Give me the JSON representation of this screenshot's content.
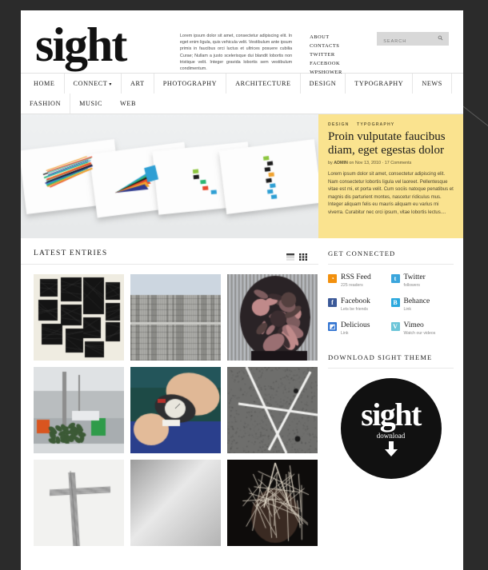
{
  "site": {
    "logo_text": "sight",
    "tagline": "Lorem ipsum dolor sit amet, consectetur adipiscing elit. In eget enim ligula, quis vehicula velit. Vestibulum ante ipsum primis in faucibus orci luctus et ultrices posuere cubilia Curae; Nullam a justo scelerisque dui blandit lobortis non tristique velit. Integer gravida lobortis sem vestibulum condimentum."
  },
  "header_links": [
    {
      "label": "ABOUT"
    },
    {
      "label": "CONTACTS"
    },
    {
      "label": "TWITTER"
    },
    {
      "label": "FACEBOOK"
    },
    {
      "label": "WPSHOWER"
    }
  ],
  "search": {
    "placeholder": "SEARCH",
    "value": "",
    "icon": "search-icon"
  },
  "nav": [
    {
      "label": "HOME",
      "has_caret": false
    },
    {
      "label": "CONNECT",
      "has_caret": true
    },
    {
      "label": "ART",
      "has_caret": false
    },
    {
      "label": "PHOTOGRAPHY",
      "has_caret": false
    },
    {
      "label": "ARCHITECTURE",
      "has_caret": false
    },
    {
      "label": "DESIGN",
      "has_caret": false
    },
    {
      "label": "TYPOGRAPHY",
      "has_caret": false
    },
    {
      "label": "NEWS",
      "has_caret": false
    },
    {
      "label": "FASHION",
      "has_caret": false
    },
    {
      "label": "MUSIC",
      "has_caret": false
    },
    {
      "label": "WEB",
      "has_caret": false
    }
  ],
  "feature": {
    "categories": [
      "DESIGN",
      "TYPOGRAPHY"
    ],
    "title": "Proin vulputate faucibus diam, eget egestas dolor",
    "meta_by": "by",
    "meta_author": "ADMIN",
    "meta_on": "on",
    "meta_date": "Nov 13, 2010",
    "meta_sep": "·",
    "meta_comments": "17 Comments",
    "excerpt": "Lorem ipsum dolor sit amet, consectetur adipiscing elit. Nam consectetur lobortis ligula vel laoreet. Pellentesque vitae est mi, et porta velit. Cum sociis natoque penatibus et magnis dis parturient montes, nascetur ridiculus mus. Integer aliquam felis eu mauris aliquam eu varius mi viverra. Curabitur nec orci ipsum, vitae lobortis lectus....",
    "accent_color": "#fae38f"
  },
  "latest": {
    "title": "LATEST ENTRIES",
    "view_list_icon": "list-view-icon",
    "view_grid_icon": "grid-view-icon",
    "thumbnails": [
      {
        "alt": "black-squares-collage"
      },
      {
        "alt": "concrete-facade-building"
      },
      {
        "alt": "paper-sculpture-face"
      },
      {
        "alt": "discarded-christmas-tree-alley"
      },
      {
        "alt": "hands-winding-wristwatch"
      },
      {
        "alt": "white-poles-on-concrete"
      },
      {
        "alt": "metal-cross-sculpture"
      },
      {
        "alt": "grey-gradient-surface"
      },
      {
        "alt": "wire-structure-dark"
      }
    ]
  },
  "sidebar": {
    "connected_title": "GET CONNECTED",
    "social": [
      {
        "name": "RSS Feed",
        "sub": "225 readers",
        "icon": "rss-icon",
        "color": "#f2900d"
      },
      {
        "name": "Twitter",
        "sub": "followers",
        "icon": "twitter-icon",
        "color": "#3aa5dc"
      },
      {
        "name": "Facebook",
        "sub": "Lets be friends",
        "icon": "facebook-icon",
        "color": "#3b5998"
      },
      {
        "name": "Behance",
        "sub": "Link",
        "icon": "behance-icon",
        "color": "#2aa8dd"
      },
      {
        "name": "Delicious",
        "sub": "Link",
        "icon": "delicious-icon",
        "color": "#3274d1"
      },
      {
        "name": "Vimeo",
        "sub": "Watch our videos",
        "icon": "vimeo-icon",
        "color": "#6cc5d8"
      }
    ],
    "download_title": "DOWNLOAD SIGHT THEME",
    "download_badge_word": "sight",
    "download_badge_sub": "download",
    "download_arrow_icon": "down-arrow-icon"
  }
}
